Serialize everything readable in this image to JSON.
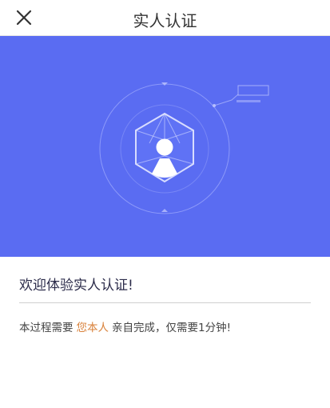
{
  "header": {
    "title": "实人认证",
    "close_icon": "close-icon"
  },
  "hero": {
    "background_color": "#5a6cf2",
    "illustration": "face-verification-icon"
  },
  "main": {
    "welcome_text": "欢迎体验实人认证!",
    "desc_before": "本过程需要",
    "desc_highlight": "您本人",
    "desc_after": "亲自完成，仅需要1分钟!",
    "highlight_color": "#d9813a"
  }
}
